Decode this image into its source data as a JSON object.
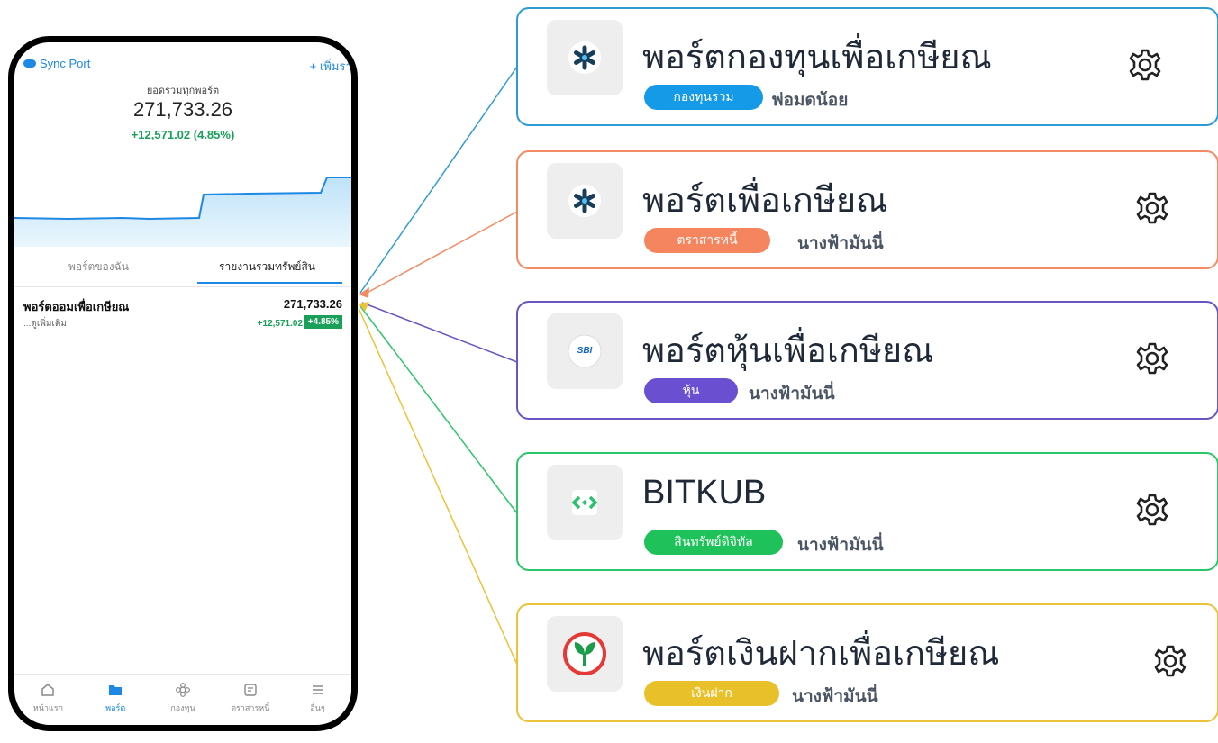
{
  "phone": {
    "sync_label": "Sync Port",
    "add_report_label": "+ เพิ่มรายงา",
    "summary_label": "ยอดรวมทุกพอร์ต",
    "total": "271,733.26",
    "gain": "+12,571.02 (4.85%)",
    "tabs": [
      {
        "label": "พอร์ตของฉัน"
      },
      {
        "label": "รายงานรวมทรัพย์สิน"
      }
    ],
    "portfolio": {
      "name": "พอร์ตออมเพื่อเกษียณ",
      "more": "...ดูเพิ่มเติม",
      "value": "271,733.26",
      "change": "+12,571.02",
      "percent": "+4.85%"
    },
    "nav": [
      {
        "label": "หน้าแรก",
        "icon": "home-icon"
      },
      {
        "label": "พอร์ต",
        "icon": "folder-icon"
      },
      {
        "label": "กองทุน",
        "icon": "flower-icon"
      },
      {
        "label": "ตราสารหนี้",
        "icon": "document-icon"
      },
      {
        "label": "อื่นๆ",
        "icon": "menu-icon"
      }
    ]
  },
  "cards": [
    {
      "title": "พอร์ตกองทุนเพื่อเกษียณ",
      "badge": "กองทุนรวม",
      "owner": "พ่อมดน้อย",
      "color": "#2e9bd6",
      "badge_color": "#149ae6",
      "logo": "asterisk-logo"
    },
    {
      "title": "พอร์ตเพื่อเกษียณ",
      "badge": "ตราสารหนี้",
      "owner": "นางฟ้ามันนี่",
      "color": "#f28b64",
      "badge_color": "#f5855e",
      "logo": "asterisk-logo"
    },
    {
      "title": "พอร์ตหุ้นเพื่อเกษียณ",
      "badge": "หุ้น",
      "owner": "นางฟ้ามันนี่",
      "color": "#6a55c2",
      "badge_color": "#6a4fd0",
      "logo": "sbi-logo",
      "logo_text": "SBI"
    },
    {
      "title": "BITKUB",
      "badge": "สินทรัพย์ดิจิทัล",
      "owner": "นางฟ้ามันนี่",
      "color": "#2cc66a",
      "badge_color": "#1fc25a",
      "logo": "bitkub-logo"
    },
    {
      "title": "พอร์ตเงินฝากเพื่อเกษียณ",
      "badge": "เงินฝาก",
      "owner": "นางฟ้ามันนี่",
      "color": "#ebc23a",
      "badge_color": "#e8c12a",
      "logo": "kbank-logo"
    }
  ]
}
